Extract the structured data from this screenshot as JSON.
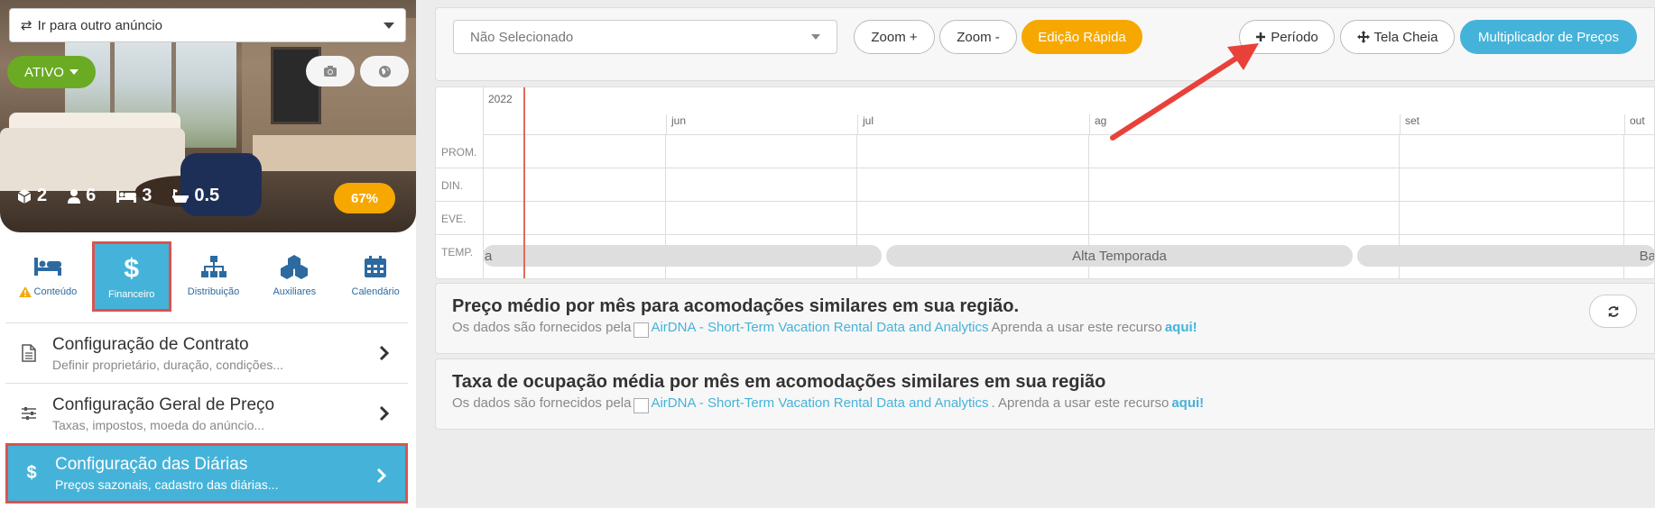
{
  "listing": {
    "switch_placeholder": "Ir para outro anúncio",
    "status": "ATIVO",
    "stats": {
      "rooms": "2",
      "guests": "6",
      "beds": "3",
      "baths": "0.5"
    },
    "occupancy": "67%"
  },
  "tabs": [
    {
      "label": "Conteúdo"
    },
    {
      "label": "Financeiro"
    },
    {
      "label": "Distribuição"
    },
    {
      "label": "Auxiliares"
    },
    {
      "label": "Calendário"
    }
  ],
  "menu": [
    {
      "title": "Configuração de Contrato",
      "desc": "Definir proprietário, duração, condições..."
    },
    {
      "title": "Configuração Geral de Preço",
      "desc": "Taxas, impostos, moeda do anúncio..."
    },
    {
      "title": "Configuração das Diárias",
      "desc": "Preços sazonais, cadastro das diárias..."
    }
  ],
  "toolbar": {
    "select_value": "Não Selecionado",
    "zoom_in": "Zoom +",
    "zoom_out": "Zoom -",
    "quick_edit": "Edição Rápida",
    "period": "Período",
    "fullscreen": "Tela Cheia",
    "multiplier": "Multiplicador de Preços"
  },
  "calendar": {
    "year": "2022",
    "months": [
      "jun",
      "jul",
      "ag",
      "set",
      "out"
    ],
    "rows": [
      "PROM.",
      "DIN.",
      "EVE.",
      "TEMP."
    ],
    "seasons": [
      "a",
      "Alta Temporada",
      "Ba"
    ]
  },
  "info": [
    {
      "heading": "Preço médio por mês para acomodações similares em sua região.",
      "prefix": "Os dados são fornecidos pela",
      "link": "AirDNA - Short-Term Vacation Rental Data and Analytics",
      "suffix": "Aprenda a usar este recurso",
      "here": "aqui!"
    },
    {
      "heading": "Taxa de ocupação média por mês em acomodações similares em sua região",
      "prefix": "Os dados são fornecidos pela",
      "link": "AirDNA - Short-Term Vacation Rental Data and Analytics",
      "suffix": ". Aprenda a usar este recurso",
      "here": "aqui!"
    }
  ],
  "colors": {
    "accent": "#45b3d9",
    "warning": "#f6a800",
    "success": "#6aab23",
    "highlight": "#d9534f"
  }
}
